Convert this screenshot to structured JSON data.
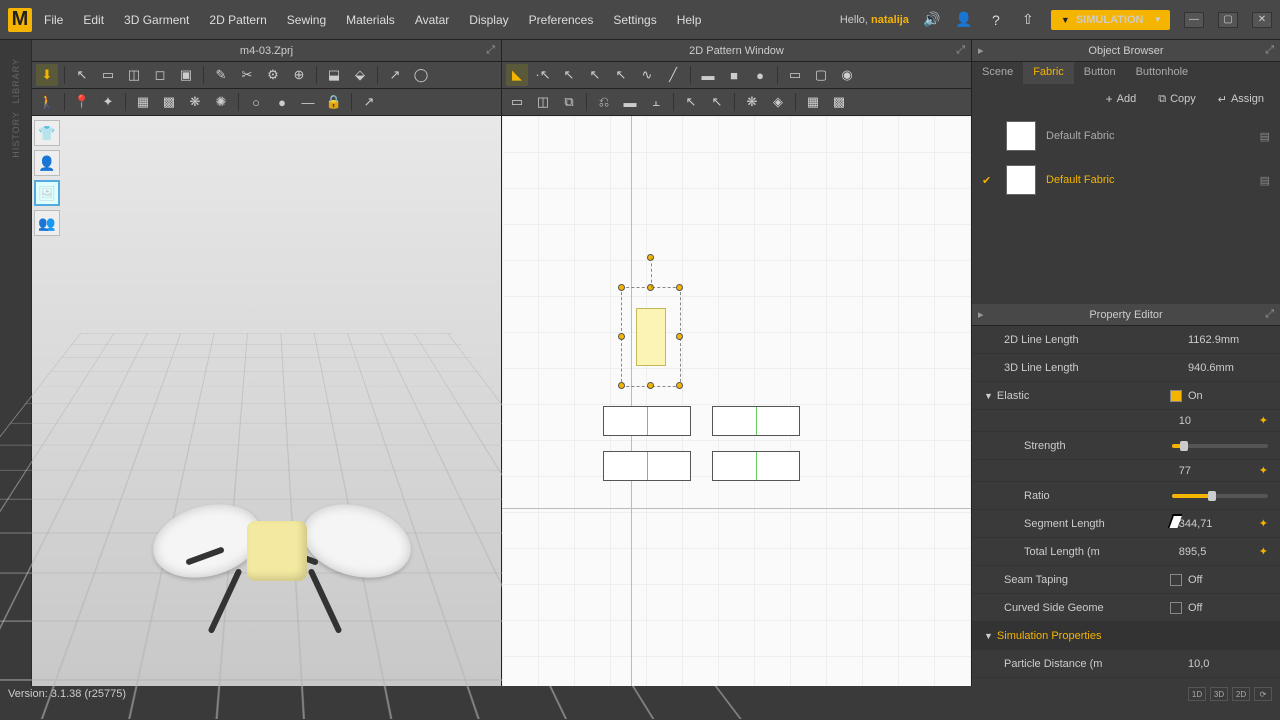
{
  "menu": [
    "File",
    "Edit",
    "3D Garment",
    "2D Pattern",
    "Sewing",
    "Materials",
    "Avatar",
    "Display",
    "Preferences",
    "Settings",
    "Help"
  ],
  "hello_prefix": "Hello,",
  "username": "natalija",
  "sim_button": "SIMULATION",
  "sidebar_tabs": {
    "library": "LIBRARY",
    "history": "HISTORY"
  },
  "project_file": "m4-03.Zprj",
  "panel_2d_title": "2D Pattern Window",
  "object_browser": {
    "title": "Object Browser",
    "tabs": [
      "Scene",
      "Fabric",
      "Button",
      "Buttonhole"
    ],
    "active_tab": "Fabric",
    "buttons": {
      "add": "Add",
      "copy": "Copy",
      "assign": "Assign"
    },
    "items": [
      {
        "name": "Default Fabric",
        "selected": false
      },
      {
        "name": "Default Fabric",
        "selected": true
      }
    ]
  },
  "property_editor": {
    "title": "Property Editor",
    "line2d_label": "2D Line Length",
    "line2d_value": "1162.9mm",
    "line3d_label": "3D Line Length",
    "line3d_value": "940.6mm",
    "elastic_label": "Elastic",
    "elastic_value": "On",
    "strength_label": "Strength",
    "strength_value": "10",
    "ratio_label": "Ratio",
    "ratio_value": "77",
    "segment_label": "Segment Length",
    "segment_value": "344,71",
    "total_label": "Total Length (m",
    "total_value": "895,5",
    "seam_label": "Seam Taping",
    "seam_value": "Off",
    "curved_label": "Curved Side Geome",
    "curved_value": "Off",
    "sim_props_label": "Simulation Properties",
    "particle_label": "Particle Distance (m",
    "particle_value": "10,0"
  },
  "status": {
    "version": "Version: 3.1.38 (r25775)",
    "btns": [
      "1D",
      "3D",
      "2D"
    ]
  }
}
